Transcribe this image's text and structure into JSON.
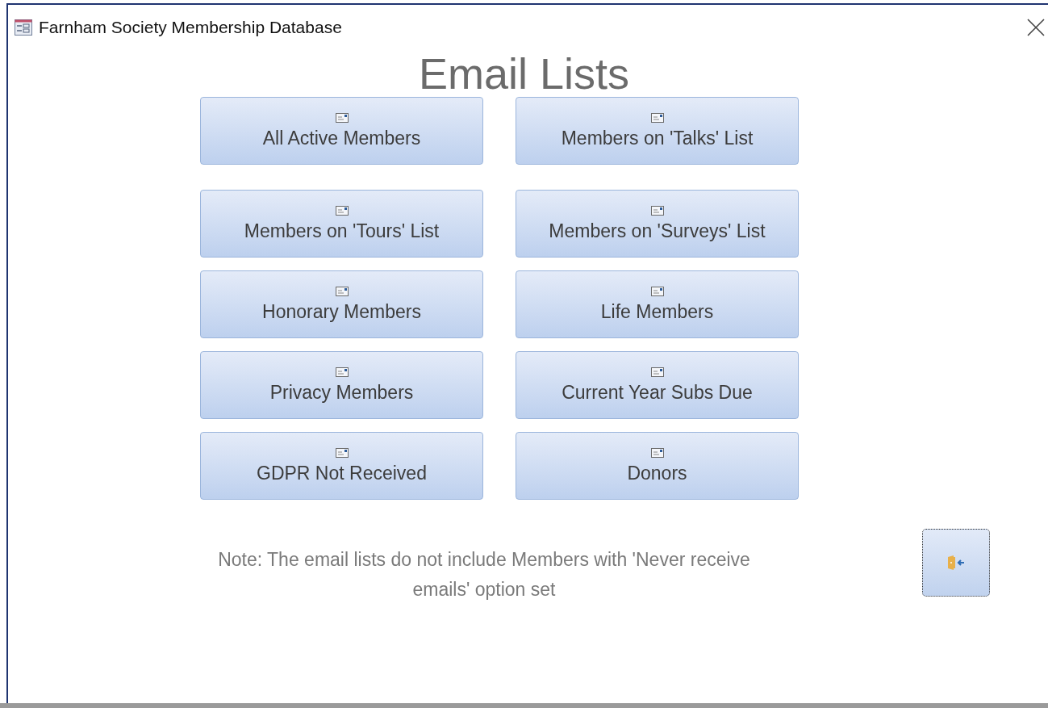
{
  "window": {
    "title": "Farnham Society Membership Database"
  },
  "heading": "Email Lists",
  "buttons": [
    {
      "label": "All Active Members"
    },
    {
      "label": "Members on 'Talks' List"
    },
    {
      "label": "Members on 'Tours' List"
    },
    {
      "label": "Members on 'Surveys' List"
    },
    {
      "label": "Honorary Members"
    },
    {
      "label": "Life Members"
    },
    {
      "label": "Privacy Members"
    },
    {
      "label": "Current Year Subs Due"
    },
    {
      "label": "GDPR Not Received"
    },
    {
      "label": "Donors"
    }
  ],
  "note": "Note: The email lists do not include Members with 'Never receive emails' option set",
  "exit_button": {
    "focused": true
  }
}
